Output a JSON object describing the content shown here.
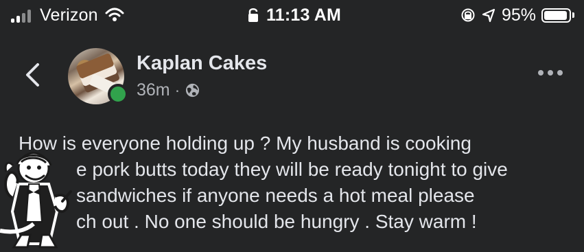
{
  "status_bar": {
    "carrier": "Verizon",
    "time": "11:13 AM",
    "battery_percent": "95%",
    "battery_level": 0.95,
    "icons": [
      "signal-icon",
      "wifi-icon",
      "lock-icon",
      "screen-rotation-lock-icon",
      "location-arrow-icon",
      "battery-icon"
    ]
  },
  "post": {
    "page_name": "Kaplan Cakes",
    "time_ago": "36m",
    "separator": "·",
    "privacy_icon": "globe-icon",
    "text_lines": [
      "How is everyone holding up ? My husband is cooking",
      "e pork butts today they will be ready tonight to give",
      "sandwiches  if anyone needs a hot meal please",
      "ch out . No one should be hungry . Stay warm !"
    ]
  },
  "ui": {
    "back_icon": "chevron-left-icon",
    "more_icon": "more-horizontal-icon",
    "online_status": "online-status-indicator"
  },
  "colors": {
    "background": "#242526",
    "primary_text": "#e4e6eb",
    "secondary_text": "#b0b3b8",
    "online": "#31a24c"
  }
}
